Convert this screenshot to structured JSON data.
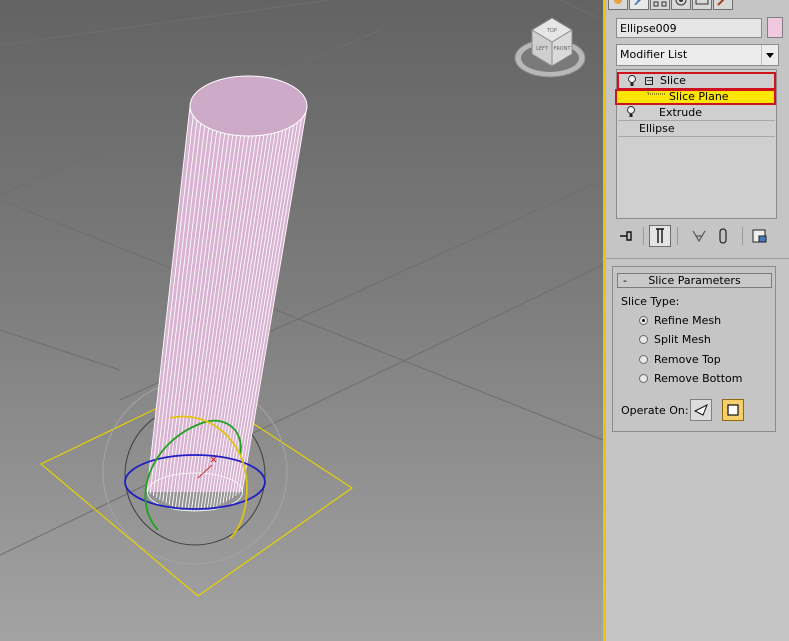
{
  "viewport": {
    "viewcube_faces": [
      "TOP",
      "FRONT",
      "LEFT"
    ],
    "colors": {
      "object": "#d9b3d2",
      "wire": "#ffffff",
      "gizmo": "#e8d000"
    }
  },
  "panel": {
    "tabs": [
      "create-icon",
      "modify-icon",
      "hierarchy-icon",
      "motion-icon",
      "display-icon",
      "utilities-icon"
    ],
    "object_name": "Ellipse009",
    "object_color": "#f0c8e0",
    "modifier_list": {
      "label": "Modifier List"
    },
    "stack": [
      {
        "label": "Slice",
        "minus": "−"
      },
      {
        "label": "Slice Plane"
      },
      {
        "label": "Extrude"
      },
      {
        "label": "Ellipse"
      }
    ],
    "toolbar": [
      "pin-stack-icon",
      "show-end-result-icon",
      "make-unique-icon",
      "remove-modifier-icon",
      "configure-sets-icon"
    ],
    "rollout": {
      "collapse": "-",
      "title": "Slice Parameters",
      "slice_type_label": "Slice Type:",
      "options": [
        "Refine Mesh",
        "Split Mesh",
        "Remove Top",
        "Remove Bottom"
      ],
      "selected_option": "Refine Mesh",
      "operate_on_label": "Operate On:",
      "operate_on_selected": "polygon"
    },
    "colors": {
      "divider": "#f0c20d",
      "highlight": "#ffe600",
      "stack_border": "#d0121e"
    }
  }
}
